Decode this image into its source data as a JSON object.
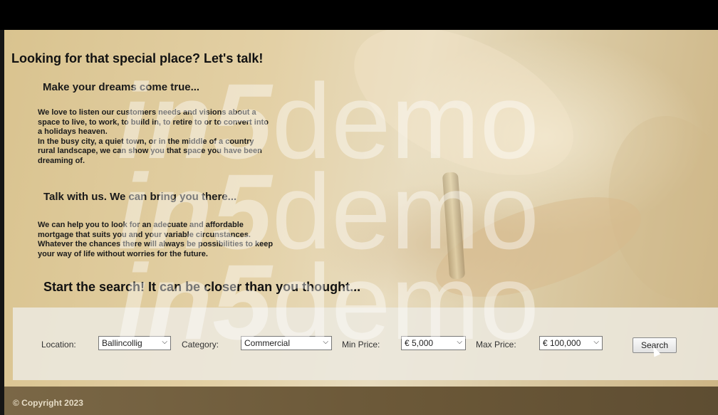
{
  "page": {
    "title": "Looking for that special place? Let's talk!",
    "section1_heading": "Make your dreams come true...",
    "section1_lines": [
      "We love to listen our customers needs and visions about a",
      "space to live, to work, to build in, to retire to or to convert into",
      "a holidays heaven.",
      "In the busy city, a quiet town, or in the middle of a country",
      "rural landscape, we can show you that space you have been",
      "dreaming of."
    ],
    "section2_heading": "Talk with us. We can bring you there...",
    "section2_lines": [
      "We can help you to look for an adecuate and affordable",
      "mortgage that suits you and your variable circunstances.",
      "Whatever the chances there will always be possibilities to keep",
      "your way of life without worries for the future."
    ],
    "cta": "Start the search! It can be closer than you thought..."
  },
  "search": {
    "location_label": "Location:",
    "location_value": "Ballincollig",
    "category_label": "Category:",
    "category_value": "Commercial",
    "min_price_label": "Min Price:",
    "min_price_value": "€ 5,000",
    "max_price_label": "Max Price:",
    "max_price_value": "€ 100,000",
    "search_button": "Search",
    "dropdown_arrow": "chevron-down-icon"
  },
  "footer": {
    "copyright": "© Copyright 2023"
  },
  "watermark": {
    "brand": "in5",
    "word": "demo"
  },
  "colors": {
    "background_tint": "#e3d0a5",
    "footer": "#6a5737",
    "text": "#111111"
  }
}
